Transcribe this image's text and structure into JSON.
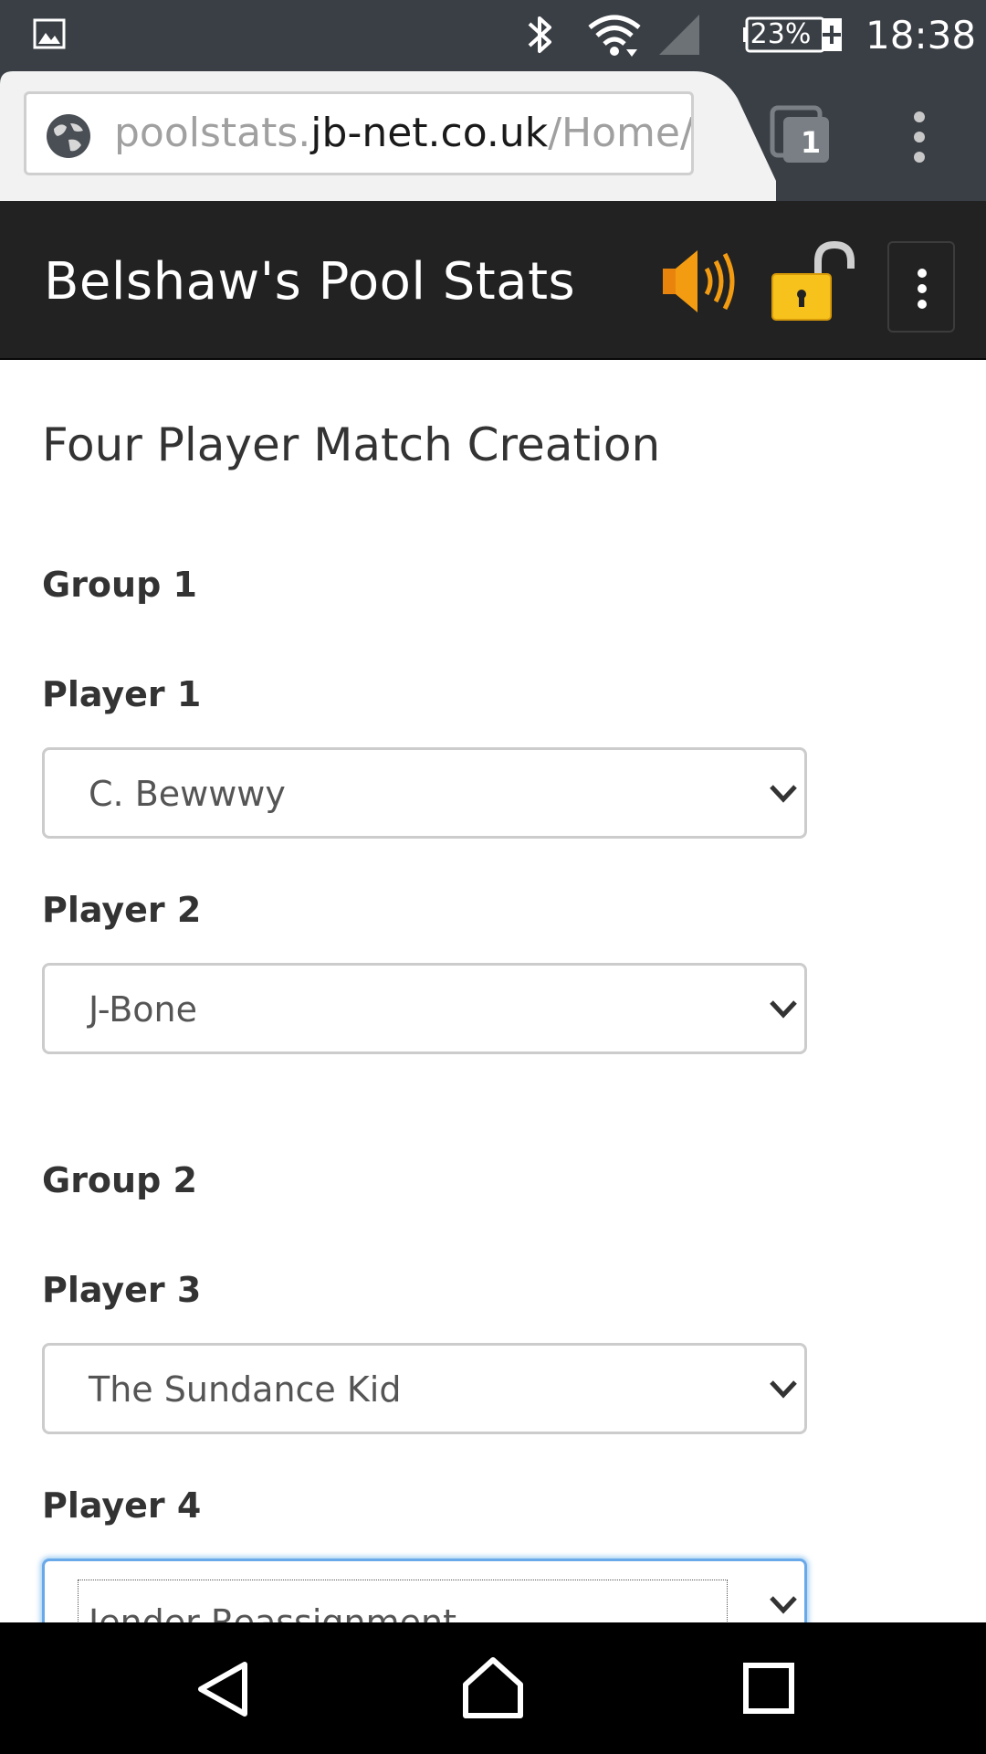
{
  "status_bar": {
    "battery": "23%",
    "time": "18:38",
    "icons": [
      "gallery-icon",
      "bluetooth-icon",
      "wifi-icon",
      "cell-signal-icon",
      "battery-charging-icon"
    ]
  },
  "browser": {
    "url_prefix": "poolstats.",
    "url_domain": "jb-net.co.uk",
    "url_suffix": "/Home/Cr",
    "tab_count": "1"
  },
  "app": {
    "title": "Belshaw's Pool Stats"
  },
  "page": {
    "title": "Four Player Match Creation",
    "groups": [
      {
        "label": "Group 1",
        "players": [
          {
            "label": "Player 1",
            "selected": "C. Bewwwy"
          },
          {
            "label": "Player 2",
            "selected": "J-Bone"
          }
        ]
      },
      {
        "label": "Group 2",
        "players": [
          {
            "label": "Player 3",
            "selected": "The Sundance Kid"
          },
          {
            "label": "Player 4",
            "selected": "Jender Reassignment"
          }
        ]
      }
    ]
  },
  "colors": {
    "status_bar_bg": "#3a3f45",
    "app_bar_bg": "#222222",
    "focus_blue": "#6aa9e9",
    "speaker_orange": "#f39c12",
    "lock_yellow": "#f7c21c"
  }
}
